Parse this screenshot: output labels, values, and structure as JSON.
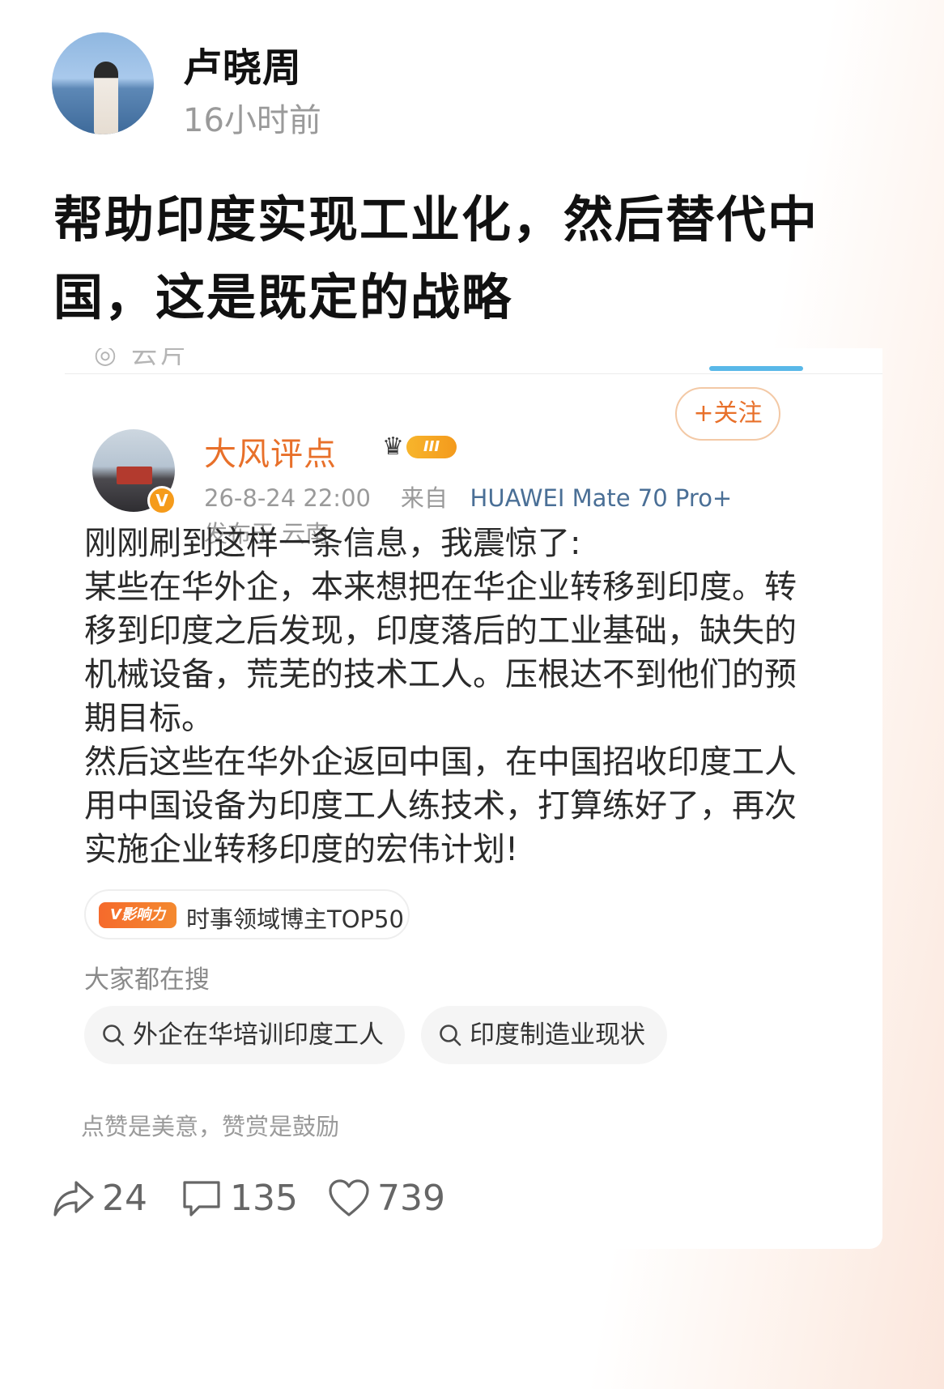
{
  "author": {
    "name": "卢晓周",
    "time": "16小时前"
  },
  "post_text": "帮助印度实现工业化，然后替代中国，这是既定的战略",
  "embedded": {
    "cut_text": "◎ 云片",
    "name": "大风评点",
    "level_badge": "III",
    "follow_label": "+关注",
    "meta_time": "26-8-24 22:00",
    "meta_from": "来自",
    "meta_device": "HUAWEI Mate 70 Pro+",
    "location": "发布于 云南",
    "body": [
      "刚刚刷到这样一条信息，我震惊了:",
      "某些在华外企，本来想把在华企业转移到印度。转移到印度之后发现，印度落后的工业基础，缺失的机械设备，荒芜的技术工人。压根达不到他们的预期目标。",
      "然后这些在华外企返回中国，在中国招收印度工人用中国设备为印度工人练技术，打算练好了，再次实施企业转移印度的宏伟计划!"
    ],
    "influence_badge": "V影响力",
    "influence_text": "时事领域博主TOP50",
    "search_heading": "大家都在搜",
    "search_chips": [
      "外企在华培训印度工人",
      "印度制造业现状"
    ],
    "reward_text": "点赞是美意，赞赏是鼓励"
  },
  "actions": {
    "repost_count": "24",
    "comment_count": "135",
    "like_count": "739"
  },
  "colors": {
    "accent_orange": "#e8702a",
    "device_blue": "#4a6f96",
    "muted_gray": "#9a9a9a"
  }
}
